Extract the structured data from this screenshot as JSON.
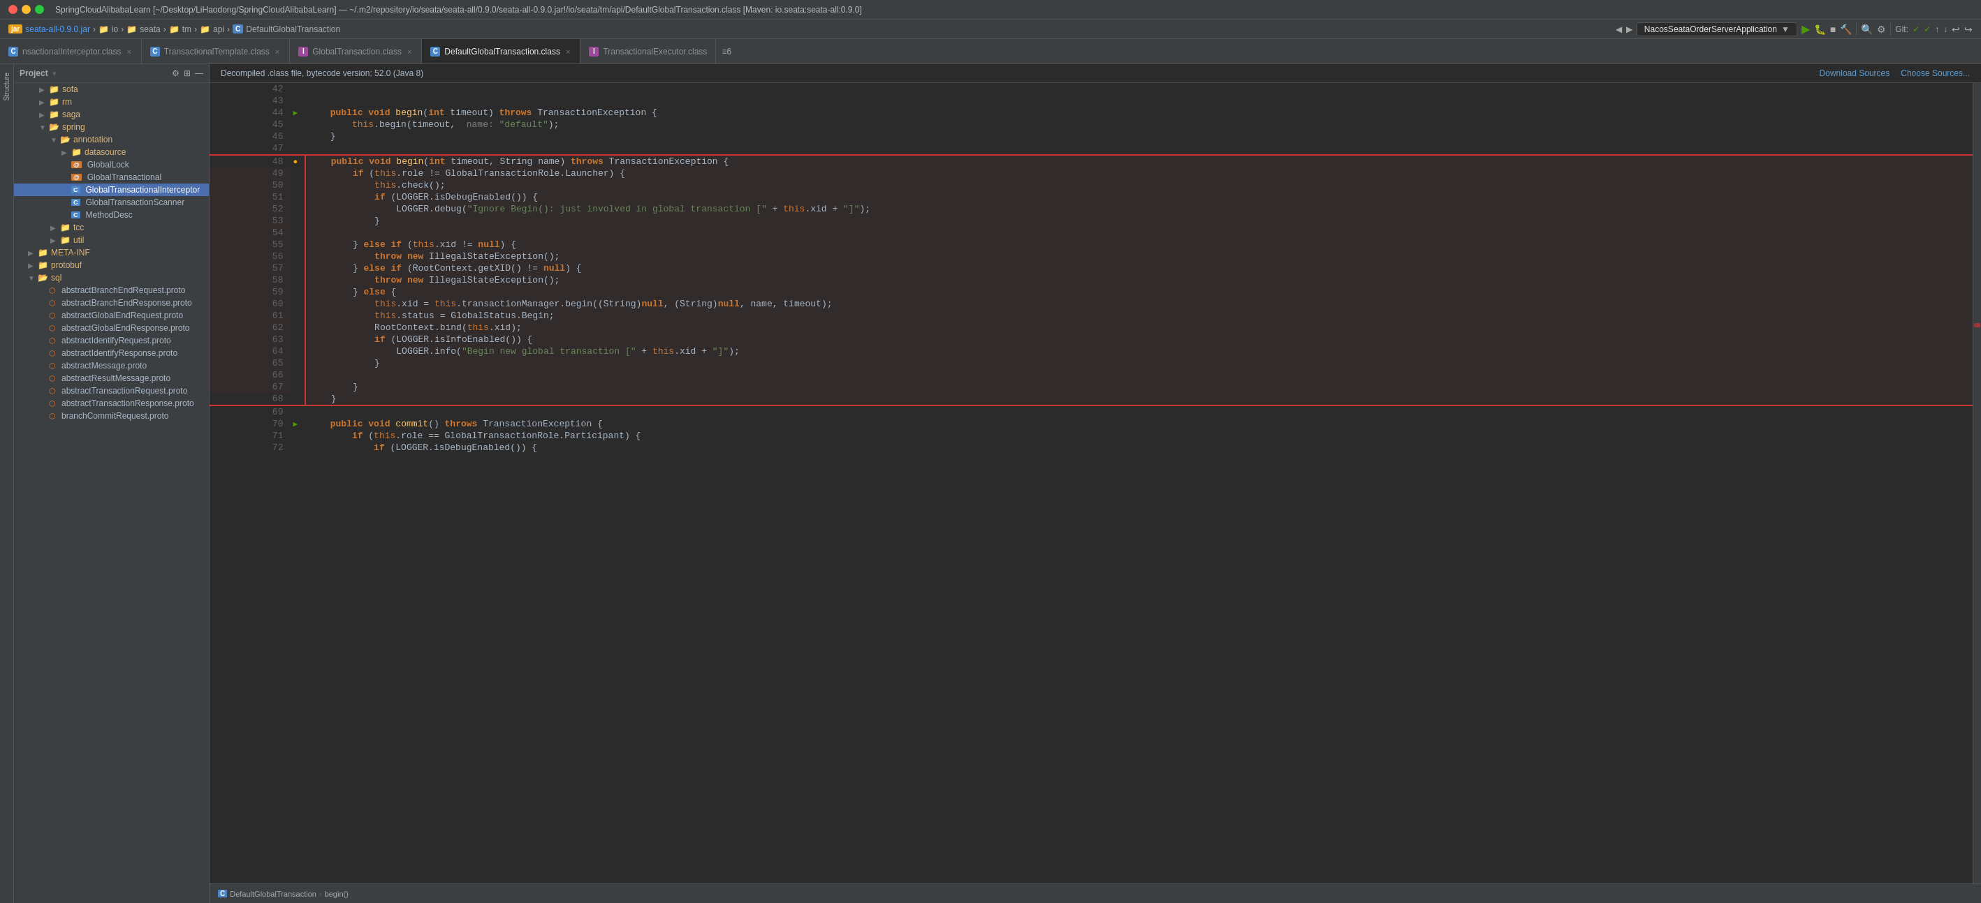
{
  "titleBar": {
    "title": "SpringCloudAlibabaLearn [~/Desktop/LiHaodong/SpringCloudAlibabaLearn] — ~/.m2/repository/io/seata/seata-all/0.9.0/seata-all-0.9.0.jar!/io/seata/tm/api/DefaultGlobalTransaction.class [Maven: io.seata:seata-all:0.9.0]"
  },
  "breadcrumbNav": {
    "items": [
      "seata-all-0.9.0.jar",
      "io",
      "seata",
      "tm",
      "api",
      "DefaultGlobalTransaction"
    ]
  },
  "tabs": [
    {
      "label": "nsactionalInterceptor.class",
      "type": "C",
      "active": false,
      "closeable": true
    },
    {
      "label": "TransactionalTemplate.class",
      "type": "C",
      "active": false,
      "closeable": true
    },
    {
      "label": "GlobalTransaction.class",
      "type": "I",
      "active": false,
      "closeable": true
    },
    {
      "label": "DefaultGlobalTransaction.class",
      "type": "C",
      "active": true,
      "closeable": true
    },
    {
      "label": "TransactionalExecutor.class",
      "type": "I",
      "active": false,
      "closeable": false
    }
  ],
  "tabCount": "≡6",
  "toolbar": {
    "runConfig": "NacosSeataOrderServerApplication",
    "git": "Git:"
  },
  "infoBar": {
    "message": "Decompiled .class file, bytecode version: 52.0 (Java 8)",
    "downloadSources": "Download Sources",
    "chooseSources": "Choose Sources..."
  },
  "sidebar": {
    "title": "Project",
    "items": [
      {
        "label": "sofa",
        "type": "folder",
        "indent": 2,
        "expanded": false
      },
      {
        "label": "rm",
        "type": "folder",
        "indent": 2,
        "expanded": false
      },
      {
        "label": "saga",
        "type": "folder",
        "indent": 2,
        "expanded": false
      },
      {
        "label": "spring",
        "type": "folder",
        "indent": 2,
        "expanded": true
      },
      {
        "label": "annotation",
        "type": "folder",
        "indent": 3,
        "expanded": true
      },
      {
        "label": "datasource",
        "type": "folder",
        "indent": 4,
        "expanded": false
      },
      {
        "label": "GlobalLock",
        "type": "C",
        "indent": 4
      },
      {
        "label": "GlobalTransactional",
        "type": "C",
        "indent": 4
      },
      {
        "label": "GlobalTransactionalInterceptor",
        "type": "C",
        "indent": 4,
        "selected": true
      },
      {
        "label": "GlobalTransactionScanner",
        "type": "C",
        "indent": 4
      },
      {
        "label": "MethodDesc",
        "type": "C",
        "indent": 4
      },
      {
        "label": "tcc",
        "type": "folder",
        "indent": 3,
        "expanded": false
      },
      {
        "label": "util",
        "type": "folder",
        "indent": 3,
        "expanded": false
      },
      {
        "label": "META-INF",
        "type": "folder",
        "indent": 1,
        "expanded": false
      },
      {
        "label": "protobuf",
        "type": "folder",
        "indent": 1,
        "expanded": false
      },
      {
        "label": "sql",
        "type": "folder",
        "indent": 1,
        "expanded": true
      },
      {
        "label": "abstractBranchEndRequest.proto",
        "type": "proto",
        "indent": 2
      },
      {
        "label": "abstractBranchEndResponse.proto",
        "type": "proto",
        "indent": 2
      },
      {
        "label": "abstractGlobalEndRequest.proto",
        "type": "proto",
        "indent": 2
      },
      {
        "label": "abstractGlobalEndResponse.proto",
        "type": "proto",
        "indent": 2
      },
      {
        "label": "abstractIdentifyRequest.proto",
        "type": "proto",
        "indent": 2
      },
      {
        "label": "abstractIdentifyResponse.proto",
        "type": "proto",
        "indent": 2
      },
      {
        "label": "abstractMessage.proto",
        "type": "proto",
        "indent": 2
      },
      {
        "label": "abstractResultMessage.proto",
        "type": "proto",
        "indent": 2
      },
      {
        "label": "abstractTransactionRequest.proto",
        "type": "proto",
        "indent": 2
      },
      {
        "label": "abstractTransactionResponse.proto",
        "type": "proto",
        "indent": 2
      },
      {
        "label": "branchCommitRequest.proto",
        "type": "proto",
        "indent": 2
      }
    ]
  },
  "code": {
    "lines": [
      {
        "num": 42,
        "code": "",
        "gutter": ""
      },
      {
        "num": 43,
        "code": "",
        "gutter": ""
      },
      {
        "num": 44,
        "code": "    public void begin(int timeout) throws TransactionException {",
        "gutter": "▶",
        "gutterClass": "run-icon-green"
      },
      {
        "num": 45,
        "code": "        this.begin(timeout,  name: \"default\");",
        "gutter": ""
      },
      {
        "num": 46,
        "code": "    }",
        "gutter": ""
      },
      {
        "num": 47,
        "code": "",
        "gutter": ""
      },
      {
        "num": 48,
        "code": "    public void begin(int timeout, String name) throws TransactionException {",
        "gutter": "⚠",
        "gutterClass": "warn-icon",
        "blockStart": true
      },
      {
        "num": 49,
        "code": "        if (this.role != GlobalTransactionRole.Launcher) {",
        "gutter": ""
      },
      {
        "num": 50,
        "code": "            this.check();",
        "gutter": ""
      },
      {
        "num": 51,
        "code": "            if (LOGGER.isDebugEnabled()) {",
        "gutter": ""
      },
      {
        "num": 52,
        "code": "                LOGGER.debug(\"Ignore Begin(): just involved in global transaction [\" + this.xid + \"]\");",
        "gutter": ""
      },
      {
        "num": 53,
        "code": "            }",
        "gutter": ""
      },
      {
        "num": 54,
        "code": "",
        "gutter": ""
      },
      {
        "num": 55,
        "code": "        } else if (this.xid != null) {",
        "gutter": ""
      },
      {
        "num": 56,
        "code": "            throw new IllegalStateException();",
        "gutter": ""
      },
      {
        "num": 57,
        "code": "        } else if (RootContext.getXID() != null) {",
        "gutter": ""
      },
      {
        "num": 58,
        "code": "            throw new IllegalStateException();",
        "gutter": ""
      },
      {
        "num": 59,
        "code": "        } else {",
        "gutter": ""
      },
      {
        "num": 60,
        "code": "            this.xid = this.transactionManager.begin((String)null, (String)null, name, timeout);",
        "gutter": ""
      },
      {
        "num": 61,
        "code": "            this.status = GlobalStatus.Begin;",
        "gutter": ""
      },
      {
        "num": 62,
        "code": "            RootContext.bind(this.xid);",
        "gutter": ""
      },
      {
        "num": 63,
        "code": "            if (LOGGER.isInfoEnabled()) {",
        "gutter": ""
      },
      {
        "num": 64,
        "code": "                LOGGER.info(\"Begin new global transaction [\" + this.xid + \"]\");",
        "gutter": ""
      },
      {
        "num": 65,
        "code": "            }",
        "gutter": ""
      },
      {
        "num": 66,
        "code": "",
        "gutter": ""
      },
      {
        "num": 67,
        "code": "        }",
        "gutter": ""
      },
      {
        "num": 68,
        "code": "    }",
        "gutter": "",
        "blockEnd": true
      },
      {
        "num": 69,
        "code": "",
        "gutter": ""
      },
      {
        "num": 70,
        "code": "    public void commit() throws TransactionException {",
        "gutter": "▶",
        "gutterClass": "run-icon-green"
      },
      {
        "num": 71,
        "code": "        if (this.role == GlobalTransactionRole.Participant) {",
        "gutter": ""
      },
      {
        "num": 72,
        "code": "            if (LOGGER.isDebugEnabled()) {",
        "gutter": ""
      }
    ]
  },
  "statusBar": {
    "breadcrumb": [
      "DefaultGlobalTransaction",
      "begin()"
    ]
  },
  "panels": {
    "left": [
      "Structure"
    ]
  }
}
